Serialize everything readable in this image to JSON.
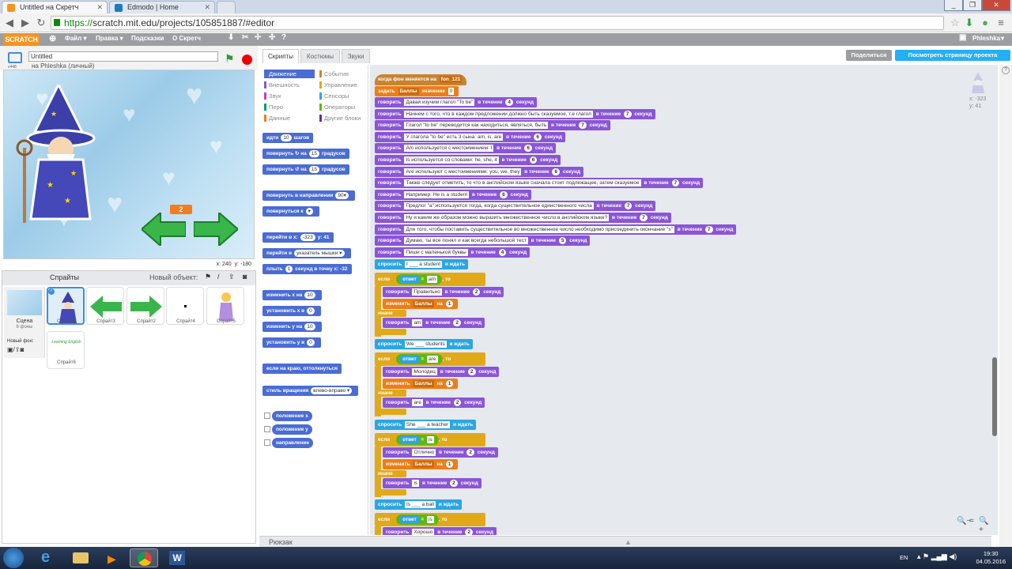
{
  "browser": {
    "tabs": [
      {
        "title": "Untitled на Скретч"
      },
      {
        "title": "Edmodo | Home"
      }
    ],
    "url": {
      "scheme": "https://",
      "rest": "scratch.mit.edu/projects/105851887/#editor"
    },
    "window_buttons": [
      "_",
      "❐",
      "✕"
    ]
  },
  "menu": {
    "logo": "SCRATCH",
    "items": [
      "Файл ▾",
      "Правка ▾",
      "Подсказки",
      "О Скретч"
    ],
    "user": "Phleshka",
    "share": "Поделиться",
    "see_project": "Посмотреть страницу проекта"
  },
  "project": {
    "title": "Untitled",
    "owner": "на Phleshka (личный)",
    "version": "v448"
  },
  "stage": {
    "coord_x": "x: 240",
    "coord_y": "y: -180",
    "score_badge": "2"
  },
  "sprites_panel": {
    "header": "Спрайты",
    "new_object": "Новый объект:",
    "scene_label": "Сцена",
    "scene_count": "6 фоны",
    "new_backdrop": "Новый фон:",
    "sprites": [
      "Спрайт1",
      "Спрайт3",
      "Спрайт2",
      "Спрайт4",
      "Спрайт5",
      "Спрайт6"
    ],
    "sprite6_text": "Learning English"
  },
  "editor_tabs": [
    "Скрипты",
    "Костюмы",
    "Звуки"
  ],
  "categories": [
    {
      "label": "Движение",
      "color": "#4a6cd4",
      "active": true
    },
    {
      "label": "Внешность",
      "color": "#8a55d7"
    },
    {
      "label": "Звук",
      "color": "#bb42c3"
    },
    {
      "label": "Перо",
      "color": "#0e9a6c"
    },
    {
      "label": "Данные",
      "color": "#ee7d16"
    },
    {
      "label": "События",
      "color": "#c88330"
    },
    {
      "label": "Управление",
      "color": "#e1a91a"
    },
    {
      "label": "Сенсоры",
      "color": "#2ca5e2"
    },
    {
      "label": "Операторы",
      "color": "#5cb712"
    },
    {
      "label": "Другие блоки",
      "color": "#632d99"
    }
  ],
  "palette_blocks": [
    {
      "text": "идти",
      "num": "10",
      "tail": "шагов"
    },
    {
      "text": "повернуть ↻ на",
      "num": "15",
      "tail": "градусов"
    },
    {
      "text": "повернуть ↺ на",
      "num": "15",
      "tail": "градусов"
    },
    {
      "text": "повернуть в направлении",
      "num": "90▾",
      "tail": ""
    },
    {
      "text": "повернуться к",
      "num": "▾",
      "tail": ""
    },
    {
      "text": "перейти в x:",
      "num": "-323",
      "tail": "y: 41"
    },
    {
      "text": "перейти в",
      "num": "указатель мышки ▾",
      "tail": ""
    },
    {
      "text": "плыть",
      "num": "1",
      "tail": "секунд в точку x: -32"
    },
    {
      "text": "изменить x на",
      "num": "10",
      "tail": ""
    },
    {
      "text": "установить x в",
      "num": "0",
      "tail": ""
    },
    {
      "text": "изменить y на",
      "num": "10",
      "tail": ""
    },
    {
      "text": "установить y в",
      "num": "0",
      "tail": ""
    },
    {
      "text": "если на краю, оттолкнуться",
      "num": "",
      "tail": ""
    },
    {
      "text": "стиль вращения",
      "num": "влево-вправо ▾",
      "tail": ""
    }
  ],
  "reporters": [
    "положение x",
    "положение y",
    "направление"
  ],
  "scripts": {
    "hat": {
      "text": "когда фон меняется на",
      "value": "fon_121"
    },
    "set": {
      "text": "задать",
      "var": "Баллы",
      "mid": "значение",
      "value": "0"
    },
    "says": [
      {
        "msg": "Давай изучим глагол \"To be\"",
        "secs": "4"
      },
      {
        "msg": "Начнем с того, что в каждом предложении должно быть сказуемое, т.е глагол",
        "secs": "7"
      },
      {
        "msg": "Глагол \"to be\" переводится как находиться, являться, быть",
        "secs": "7"
      },
      {
        "msg": "У глагола \"to be\" есть 3 сына: am, is, are",
        "secs": "6"
      },
      {
        "msg": "Am используется с местоимением: I",
        "secs": "6"
      },
      {
        "msg": "Is используется со словами: he, she, it",
        "secs": "6"
      },
      {
        "msg": "Are используют с местоимениями: you, we, they",
        "secs": "6"
      },
      {
        "msg": "Также следует отметить, то что в английском языке сначала стоит подлежащее, затем сказуемое",
        "secs": "7"
      },
      {
        "msg": "Например: He is a student",
        "secs": "6"
      },
      {
        "msg": "Предлог \"a\" используется тогда, когда существительное единственного числа",
        "secs": "7"
      },
      {
        "msg": "Ну и каким же образом можно выразить множественное число в английском языке?",
        "secs": "7"
      },
      {
        "msg": "Для того, чтобы поставить существительное во множественное число необходимо присоединить окончание \"s\"",
        "secs": "7"
      },
      {
        "msg": "Думаю, ты все понял и как всегда небольшой тест",
        "secs": "5"
      },
      {
        "msg": "Пиши с маленькой буквы",
        "secs": "4"
      }
    ],
    "questions": [
      {
        "ask": "I ___ a student",
        "answer": "am",
        "praise": "Правильно",
        "p_secs": "2",
        "else_secs": "2"
      },
      {
        "ask": "We ___ students",
        "answer": "are",
        "praise": "Молодец",
        "p_secs": "2",
        "else_secs": "2"
      },
      {
        "ask": "She ___ a teacher",
        "answer": "is",
        "praise": "Отлично",
        "p_secs": "2",
        "else_secs": "2"
      },
      {
        "ask": "Is ___ a ball",
        "answer": "is",
        "praise": "Хорошо",
        "p_secs": "2",
        "else_secs": "2"
      }
    ],
    "labels": {
      "say": "говорить",
      "during": "в течение",
      "seconds": "секунд",
      "ask": "спросить",
      "and_wait": "и ждать",
      "if": "если",
      "then": ", то",
      "answer": "ответ",
      "change": "изменить",
      "var": "Баллы",
      "by": "на",
      "one": "1",
      "else": "иначе"
    }
  },
  "sprite_info": {
    "x": "x: -323",
    "y": "y: 41"
  },
  "backpack": "Рюкзак",
  "zoom": [
    "🔍−",
    "=",
    "🔍+"
  ],
  "taskbar": {
    "lang": "EN",
    "time": "19:30",
    "date": "04.05.2016"
  }
}
